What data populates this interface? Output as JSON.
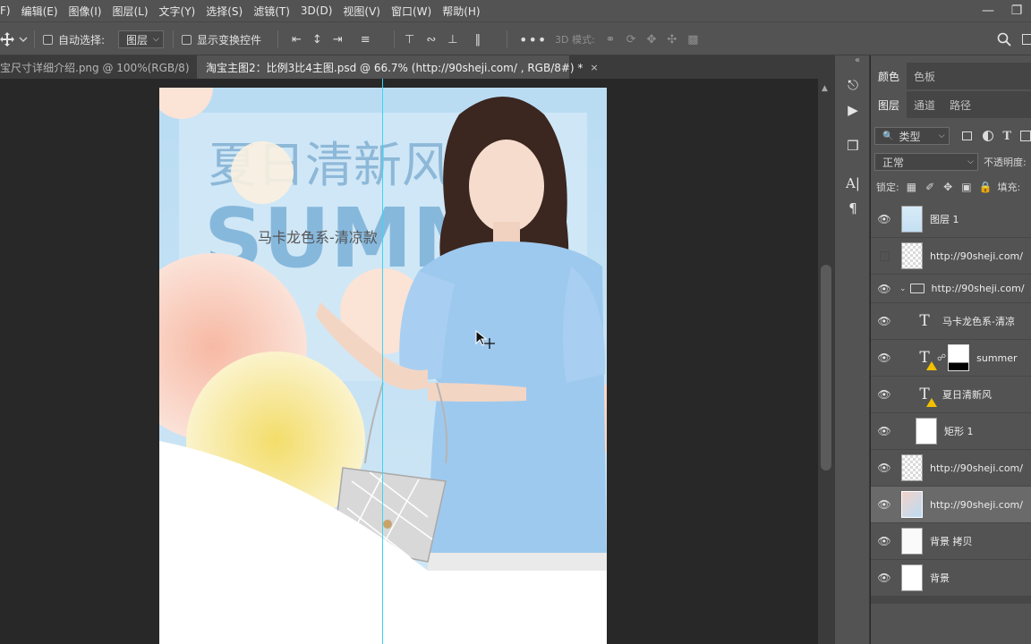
{
  "menu": [
    "编辑(E)",
    "图像(I)",
    "图层(L)",
    "文字(Y)",
    "选择(S)",
    "滤镜(T)",
    "3D(D)",
    "视图(V)",
    "窗口(W)",
    "帮助(H)"
  ],
  "menu_cut_first": "F)",
  "options": {
    "auto_select_label": "自动选择:",
    "auto_select_value": "图层",
    "show_transform_label": "显示变换控件",
    "mode_3d_label": "3D 模式:",
    "more_icon": "more-icon"
  },
  "tabs": [
    {
      "label": "宝尺寸详细介绍.png @ 100%(RGB/8)",
      "close": "×",
      "active": false
    },
    {
      "label": "淘宝主图2：比例3比4主图.psd @ 66.7% (http://90sheji.com/ , RGB/8#) *",
      "close": "×",
      "active": true
    }
  ],
  "banner": {
    "title_cn": "夏日清新风",
    "title_en": "SUMM",
    "subtitle": "马卡龙色系-清凉款"
  },
  "panels": {
    "top_tabs": [
      "颜色",
      "色板"
    ],
    "layer_tabs": [
      "图层",
      "通道",
      "路径"
    ],
    "filter_label": "类型",
    "blend_mode": "正常",
    "opacity_label": "不透明度:",
    "lock_label": "锁定:",
    "fill_label": "填充:"
  },
  "layers": [
    {
      "name": "图层 1",
      "visible": true,
      "kind": "image"
    },
    {
      "name": "http://90sheji.com/",
      "visible": false,
      "kind": "image"
    },
    {
      "name": "http://90sheji.com/",
      "visible": true,
      "kind": "group"
    },
    {
      "name": "马卡龙色系-清凉",
      "visible": true,
      "kind": "text"
    },
    {
      "name": "summer",
      "visible": true,
      "kind": "text-mask"
    },
    {
      "name": "夏日清新风",
      "visible": true,
      "kind": "text-warn"
    },
    {
      "name": "矩形 1",
      "visible": true,
      "kind": "shape"
    },
    {
      "name": "http://90sheji.com/",
      "visible": true,
      "kind": "image"
    },
    {
      "name": "http://90sheji.com/",
      "visible": true,
      "kind": "image-selected"
    },
    {
      "name": "背景 拷贝",
      "visible": true,
      "kind": "image"
    },
    {
      "name": "背景",
      "visible": true,
      "kind": "image"
    }
  ],
  "colors": {
    "menubar": "#535353",
    "canvas_bg": "#282828",
    "guide": "#38d6f5",
    "banner_sky": "#bcdcf0",
    "shirt": "#9ec9ee",
    "warning": "#f2c000"
  }
}
